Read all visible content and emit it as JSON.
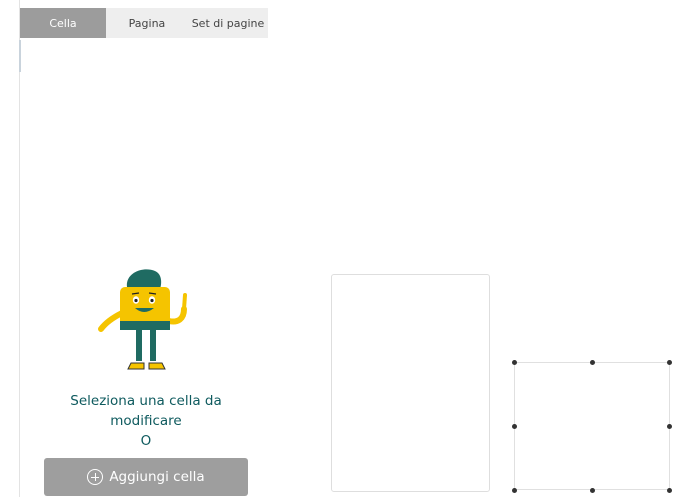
{
  "tabs": [
    {
      "label": "Cella",
      "active": true
    },
    {
      "label": "Pagina",
      "active": false
    },
    {
      "label": "Set di pagine",
      "active": false
    }
  ],
  "empty_state": {
    "line1": "Seleziona una cella da",
    "line2": "modificare",
    "line3": "O"
  },
  "add_cell_button": {
    "label": "Aggiungi cella",
    "icon": "plus-circle-icon"
  },
  "colors": {
    "tab_active_bg": "#9c9c9c",
    "tab_bar_bg": "#eeeeee",
    "text_teal": "#0e5a5e",
    "button_gray": "#9e9e9e",
    "mascot_yellow": "#f5c400",
    "mascot_green": "#1f6b62"
  }
}
